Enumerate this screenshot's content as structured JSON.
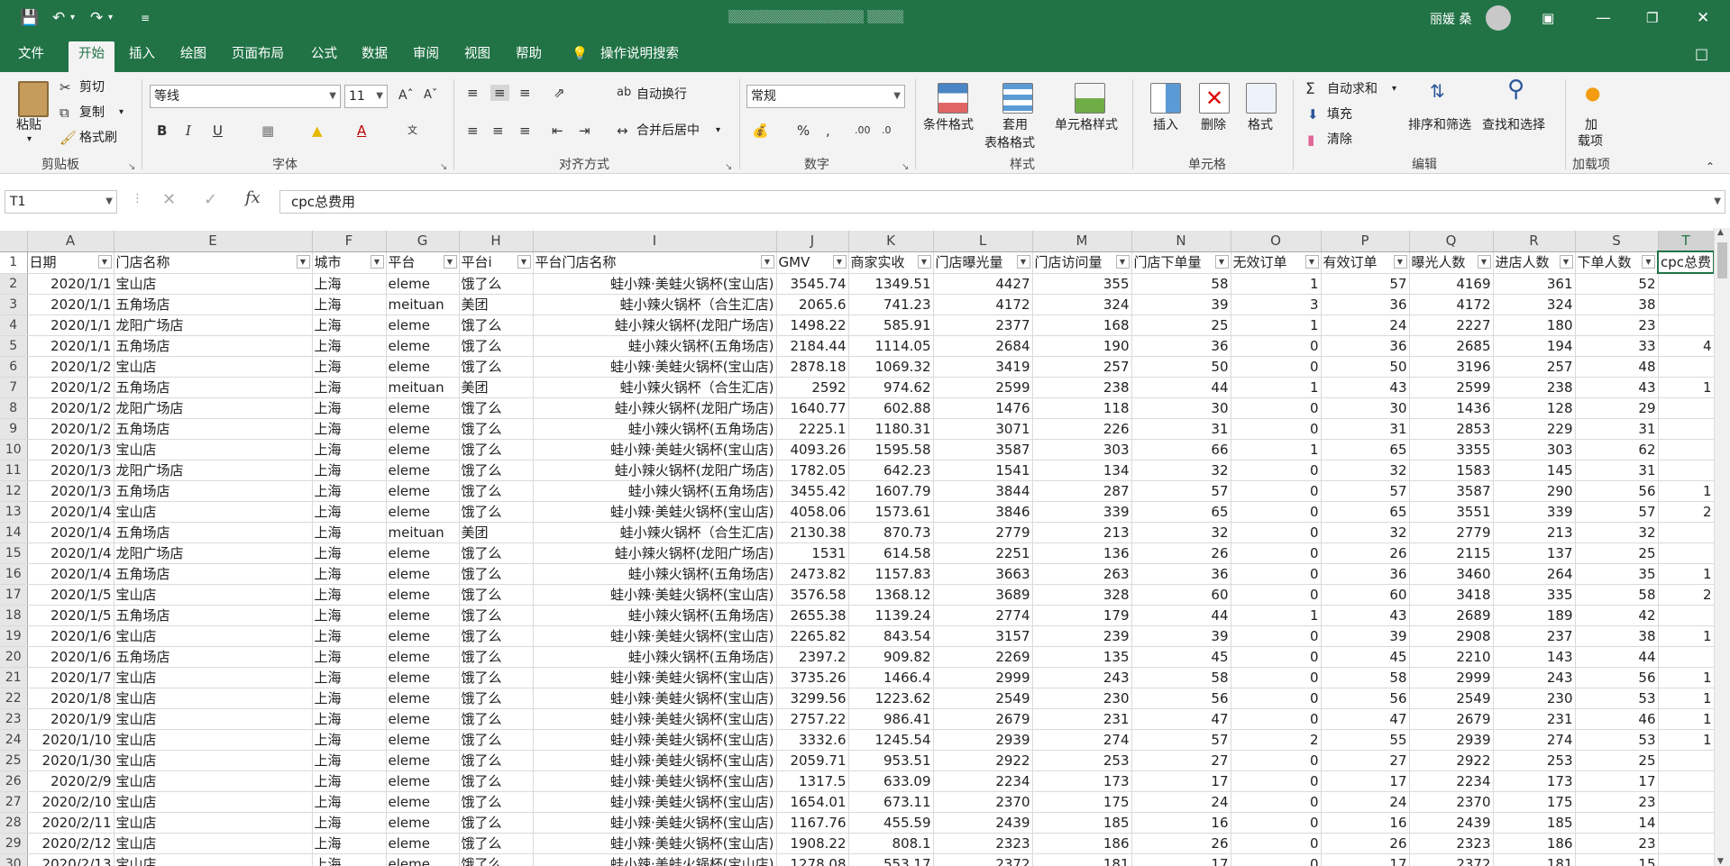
{
  "titlebar": {
    "user_name": "丽媛 桑",
    "doc_title_blurred": "▒▒▒▒▒▒▒▒▒▒▒▒▒▒▒  ▒▒▒▒"
  },
  "menu": {
    "tabs": [
      "文件",
      "开始",
      "插入",
      "绘图",
      "页面布局",
      "公式",
      "数据",
      "审阅",
      "视图",
      "帮助"
    ],
    "active": "开始",
    "tell_me": "操作说明搜索"
  },
  "ribbon": {
    "clipboard": {
      "paste": "粘贴",
      "cut": "剪切",
      "copy": "复制",
      "format_painter": "格式刷",
      "group": "剪贴板"
    },
    "font": {
      "name": "等线",
      "size": "11",
      "group": "字体"
    },
    "alignment": {
      "wrap": "自动换行",
      "merge": "合并后居中",
      "group": "对齐方式"
    },
    "number": {
      "format": "常规",
      "group": "数字"
    },
    "styles": {
      "conditional": "条件格式",
      "table": "套用",
      "table2": "表格格式",
      "cell_styles": "单元格样式",
      "group": "样式"
    },
    "cells": {
      "insert": "插入",
      "delete": "删除",
      "format": "格式",
      "group": "单元格"
    },
    "editing": {
      "autosum": "自动求和",
      "fill": "填充",
      "clear": "清除",
      "sort": "排序和筛选",
      "find": "查找和选择",
      "group": "编辑"
    },
    "addins": {
      "label1": "加",
      "label2": "载项",
      "group": "加载项"
    }
  },
  "formula_bar": {
    "name_box": "T1",
    "formula": "cpc总费用"
  },
  "sheet": {
    "selected_column": "T",
    "columns": [
      "A",
      "E",
      "F",
      "G",
      "H",
      "I",
      "J",
      "K",
      "L",
      "M",
      "N",
      "O",
      "P",
      "Q",
      "R",
      "S",
      "T"
    ],
    "headers": [
      "日期",
      "门店名称",
      "城市",
      "平台",
      "平台i",
      "平台门店名称",
      "GMV",
      "商家实收",
      "门店曝光量",
      "门店访问量",
      "门店下单量",
      "无效订单",
      "有效订单",
      "曝光人数",
      "进店人数",
      "下单人数",
      "cpc总费"
    ],
    "rows": [
      [
        "2",
        "2020/1/1",
        "宝山店",
        "上海",
        "eleme",
        "饿了么",
        "蛙小辣·美蛙火锅杯(宝山店)",
        "3545.74",
        "1349.51",
        "4427",
        "355",
        "58",
        "1",
        "57",
        "4169",
        "361",
        "52",
        ""
      ],
      [
        "3",
        "2020/1/1",
        "五角场店",
        "上海",
        "meituan",
        "美团",
        "蛙小辣火锅杯（合生汇店)",
        "2065.6",
        "741.23",
        "4172",
        "324",
        "39",
        "3",
        "36",
        "4172",
        "324",
        "38",
        ""
      ],
      [
        "4",
        "2020/1/1",
        "龙阳广场店",
        "上海",
        "eleme",
        "饿了么",
        "蛙小辣火锅杯(龙阳广场店)",
        "1498.22",
        "585.91",
        "2377",
        "168",
        "25",
        "1",
        "24",
        "2227",
        "180",
        "23",
        ""
      ],
      [
        "5",
        "2020/1/1",
        "五角场店",
        "上海",
        "eleme",
        "饿了么",
        "蛙小辣火锅杯(五角场店)",
        "2184.44",
        "1114.05",
        "2684",
        "190",
        "36",
        "0",
        "36",
        "2685",
        "194",
        "33",
        "4"
      ],
      [
        "6",
        "2020/1/2",
        "宝山店",
        "上海",
        "eleme",
        "饿了么",
        "蛙小辣·美蛙火锅杯(宝山店)",
        "2878.18",
        "1069.32",
        "3419",
        "257",
        "50",
        "0",
        "50",
        "3196",
        "257",
        "48",
        ""
      ],
      [
        "7",
        "2020/1/2",
        "五角场店",
        "上海",
        "meituan",
        "美团",
        "蛙小辣火锅杯（合生汇店)",
        "2592",
        "974.62",
        "2599",
        "238",
        "44",
        "1",
        "43",
        "2599",
        "238",
        "43",
        "1"
      ],
      [
        "8",
        "2020/1/2",
        "龙阳广场店",
        "上海",
        "eleme",
        "饿了么",
        "蛙小辣火锅杯(龙阳广场店)",
        "1640.77",
        "602.88",
        "1476",
        "118",
        "30",
        "0",
        "30",
        "1436",
        "128",
        "29",
        ""
      ],
      [
        "9",
        "2020/1/2",
        "五角场店",
        "上海",
        "eleme",
        "饿了么",
        "蛙小辣火锅杯(五角场店)",
        "2225.1",
        "1180.31",
        "3071",
        "226",
        "31",
        "0",
        "31",
        "2853",
        "229",
        "31",
        ""
      ],
      [
        "10",
        "2020/1/3",
        "宝山店",
        "上海",
        "eleme",
        "饿了么",
        "蛙小辣·美蛙火锅杯(宝山店)",
        "4093.26",
        "1595.58",
        "3587",
        "303",
        "66",
        "1",
        "65",
        "3355",
        "303",
        "62",
        ""
      ],
      [
        "11",
        "2020/1/3",
        "龙阳广场店",
        "上海",
        "eleme",
        "饿了么",
        "蛙小辣火锅杯(龙阳广场店)",
        "1782.05",
        "642.23",
        "1541",
        "134",
        "32",
        "0",
        "32",
        "1583",
        "145",
        "31",
        ""
      ],
      [
        "12",
        "2020/1/3",
        "五角场店",
        "上海",
        "eleme",
        "饿了么",
        "蛙小辣火锅杯(五角场店)",
        "3455.42",
        "1607.79",
        "3844",
        "287",
        "57",
        "0",
        "57",
        "3587",
        "290",
        "56",
        "1"
      ],
      [
        "13",
        "2020/1/4",
        "宝山店",
        "上海",
        "eleme",
        "饿了么",
        "蛙小辣·美蛙火锅杯(宝山店)",
        "4058.06",
        "1573.61",
        "3846",
        "339",
        "65",
        "0",
        "65",
        "3551",
        "339",
        "57",
        "2"
      ],
      [
        "14",
        "2020/1/4",
        "五角场店",
        "上海",
        "meituan",
        "美团",
        "蛙小辣火锅杯（合生汇店)",
        "2130.38",
        "870.73",
        "2779",
        "213",
        "32",
        "0",
        "32",
        "2779",
        "213",
        "32",
        ""
      ],
      [
        "15",
        "2020/1/4",
        "龙阳广场店",
        "上海",
        "eleme",
        "饿了么",
        "蛙小辣火锅杯(龙阳广场店)",
        "1531",
        "614.58",
        "2251",
        "136",
        "26",
        "0",
        "26",
        "2115",
        "137",
        "25",
        ""
      ],
      [
        "16",
        "2020/1/4",
        "五角场店",
        "上海",
        "eleme",
        "饿了么",
        "蛙小辣火锅杯(五角场店)",
        "2473.82",
        "1157.83",
        "3663",
        "263",
        "36",
        "0",
        "36",
        "3460",
        "264",
        "35",
        "1"
      ],
      [
        "17",
        "2020/1/5",
        "宝山店",
        "上海",
        "eleme",
        "饿了么",
        "蛙小辣·美蛙火锅杯(宝山店)",
        "3576.58",
        "1368.12",
        "3689",
        "328",
        "60",
        "0",
        "60",
        "3418",
        "335",
        "58",
        "2"
      ],
      [
        "18",
        "2020/1/5",
        "五角场店",
        "上海",
        "eleme",
        "饿了么",
        "蛙小辣火锅杯(五角场店)",
        "2655.38",
        "1139.24",
        "2774",
        "179",
        "44",
        "1",
        "43",
        "2689",
        "189",
        "42",
        ""
      ],
      [
        "19",
        "2020/1/6",
        "宝山店",
        "上海",
        "eleme",
        "饿了么",
        "蛙小辣·美蛙火锅杯(宝山店)",
        "2265.82",
        "843.54",
        "3157",
        "239",
        "39",
        "0",
        "39",
        "2908",
        "237",
        "38",
        "1"
      ],
      [
        "20",
        "2020/1/6",
        "五角场店",
        "上海",
        "eleme",
        "饿了么",
        "蛙小辣火锅杯(五角场店)",
        "2397.2",
        "909.82",
        "2269",
        "135",
        "45",
        "0",
        "45",
        "2210",
        "143",
        "44",
        ""
      ],
      [
        "21",
        "2020/1/7",
        "宝山店",
        "上海",
        "eleme",
        "饿了么",
        "蛙小辣·美蛙火锅杯(宝山店)",
        "3735.26",
        "1466.4",
        "2999",
        "243",
        "58",
        "0",
        "58",
        "2999",
        "243",
        "56",
        "1"
      ],
      [
        "22",
        "2020/1/8",
        "宝山店",
        "上海",
        "eleme",
        "饿了么",
        "蛙小辣·美蛙火锅杯(宝山店)",
        "3299.56",
        "1223.62",
        "2549",
        "230",
        "56",
        "0",
        "56",
        "2549",
        "230",
        "53",
        "1"
      ],
      [
        "23",
        "2020/1/9",
        "宝山店",
        "上海",
        "eleme",
        "饿了么",
        "蛙小辣·美蛙火锅杯(宝山店)",
        "2757.22",
        "986.41",
        "2679",
        "231",
        "47",
        "0",
        "47",
        "2679",
        "231",
        "46",
        "1"
      ],
      [
        "24",
        "2020/1/10",
        "宝山店",
        "上海",
        "eleme",
        "饿了么",
        "蛙小辣·美蛙火锅杯(宝山店)",
        "3332.6",
        "1245.54",
        "2939",
        "274",
        "57",
        "2",
        "55",
        "2939",
        "274",
        "53",
        "1"
      ],
      [
        "25",
        "2020/1/30",
        "宝山店",
        "上海",
        "eleme",
        "饿了么",
        "蛙小辣·美蛙火锅杯(宝山店)",
        "2059.71",
        "953.51",
        "2922",
        "253",
        "27",
        "0",
        "27",
        "2922",
        "253",
        "25",
        ""
      ],
      [
        "26",
        "2020/2/9",
        "宝山店",
        "上海",
        "eleme",
        "饿了么",
        "蛙小辣·美蛙火锅杯(宝山店)",
        "1317.5",
        "633.09",
        "2234",
        "173",
        "17",
        "0",
        "17",
        "2234",
        "173",
        "17",
        ""
      ],
      [
        "27",
        "2020/2/10",
        "宝山店",
        "上海",
        "eleme",
        "饿了么",
        "蛙小辣·美蛙火锅杯(宝山店)",
        "1654.01",
        "673.11",
        "2370",
        "175",
        "24",
        "0",
        "24",
        "2370",
        "175",
        "23",
        ""
      ],
      [
        "28",
        "2020/2/11",
        "宝山店",
        "上海",
        "eleme",
        "饿了么",
        "蛙小辣·美蛙火锅杯(宝山店)",
        "1167.76",
        "455.59",
        "2439",
        "185",
        "16",
        "0",
        "16",
        "2439",
        "185",
        "14",
        ""
      ],
      [
        "29",
        "2020/2/12",
        "宝山店",
        "上海",
        "eleme",
        "饿了么",
        "蛙小辣·美蛙火锅杯(宝山店)",
        "1908.22",
        "808.1",
        "2323",
        "186",
        "26",
        "0",
        "26",
        "2323",
        "186",
        "23",
        ""
      ],
      [
        "30",
        "2020/2/13",
        "宝山店",
        "上海",
        "eleme",
        "饿了么",
        "蛙小辣·美蛙火锅杯(宝山店)",
        "1278.08",
        "553.17",
        "2372",
        "181",
        "17",
        "0",
        "17",
        "2372",
        "181",
        "15",
        ""
      ]
    ]
  }
}
